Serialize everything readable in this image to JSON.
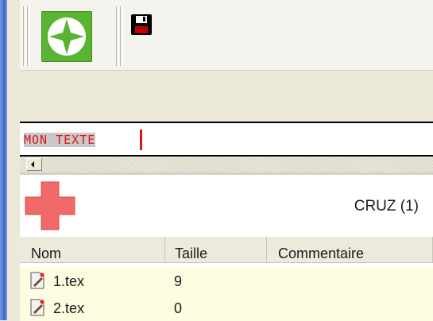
{
  "toolbar": {
    "new_icon": "green-star-icon",
    "save_icon": "floppy-disk-icon"
  },
  "text_field": {
    "value": "MON TEXTE"
  },
  "panel": {
    "add_icon": "red-plus-icon",
    "title": "CRUZ (1)"
  },
  "file_list": {
    "columns": [
      "Nom",
      "Taille",
      "Commentaire"
    ],
    "rows": [
      {
        "icon": "tex-file-icon",
        "name": "1.tex",
        "size": "9",
        "comment": ""
      },
      {
        "icon": "tex-file-icon",
        "name": "2.tex",
        "size": "0",
        "comment": ""
      }
    ]
  },
  "colors": {
    "accent_green": "#58b431",
    "text_red": "#e01515",
    "row_highlight": "#fffde1"
  }
}
